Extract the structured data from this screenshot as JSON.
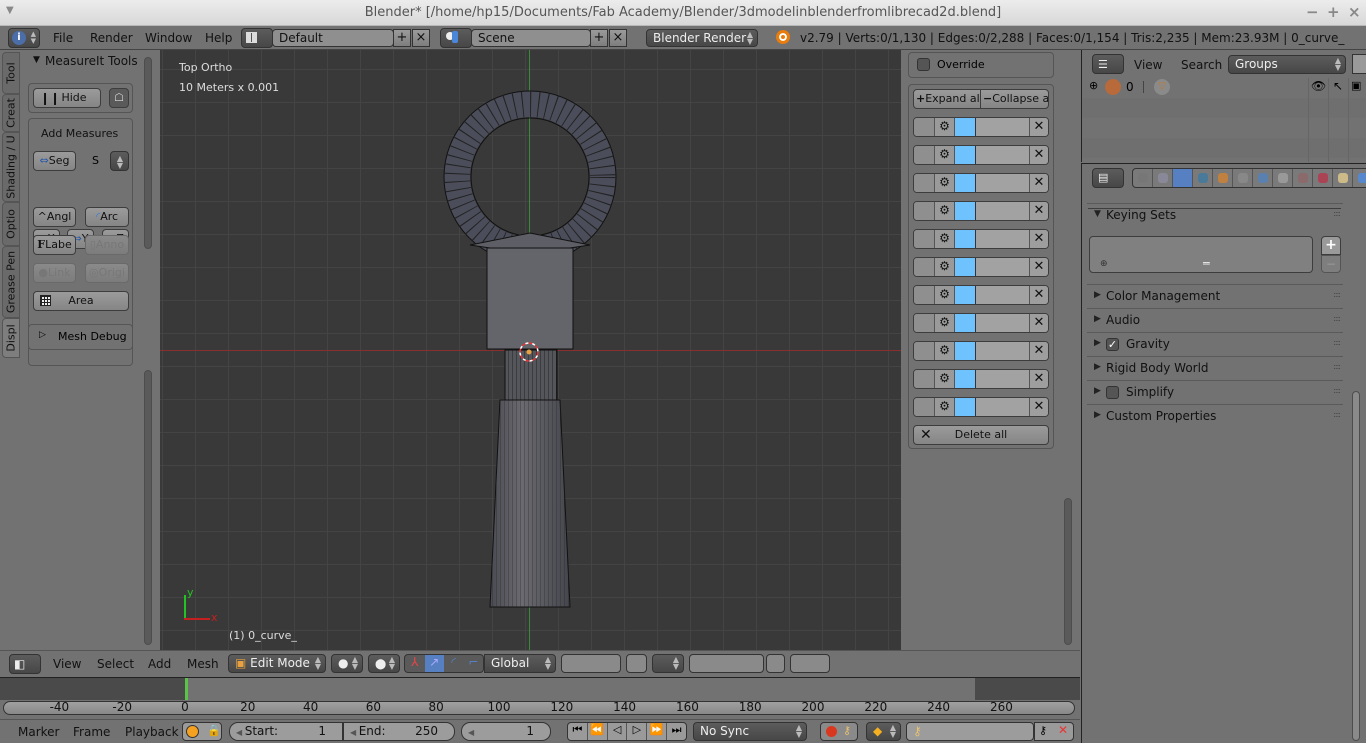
{
  "window": {
    "title": "Blender* [/home/hp15/Documents/Fab Academy/Blender/3dmodelinblenderfromlibrecad2d.blend]",
    "controls": [
      "−",
      "+",
      "×"
    ]
  },
  "info_header": {
    "editor_icon": "info-icon",
    "menus": [
      "File",
      "Render",
      "Window",
      "Help"
    ],
    "screen_layout": "Default",
    "scene": "Scene",
    "render_engine": "Blender Render",
    "stats": "v2.79 | Verts:0/1,130 | Edges:0/2,288 | Faces:0/1,154 | Tris:2,235 | Mem:23.93M | 0_curve_"
  },
  "tool_shelf": {
    "tabs": [
      "Tool",
      "Creat",
      "Shading / U",
      "Optio",
      "Grease Pen",
      "Displ"
    ],
    "active_tab": "Displ",
    "panel_title": "MeasureIt Tools",
    "hide_button": "Hide",
    "add_measures_label": "Add Measures",
    "buttons": {
      "seg": "Seg",
      "s_label": "S",
      "x": "X",
      "y": "Y",
      "z": "Z",
      "angle": "Angl",
      "arc": "Arc",
      "label": "Labe",
      "anno": "Anno",
      "link": "Link",
      "origin": "Origi",
      "area": "Area"
    },
    "mesh_debug": "Mesh Debug"
  },
  "viewport": {
    "view_name": "Top Ortho",
    "scale": "10 Meters x 0.001",
    "object_label": "(1) 0_curve_",
    "axis_x": "x",
    "axis_y": "y"
  },
  "measureit_list": {
    "override_label": "Override",
    "expand_all": "Expand al",
    "collapse_all": "Collapse a",
    "rows": 11,
    "row_color": "#6ec3ff",
    "delete_all": "Delete all"
  },
  "outliner": {
    "menus": [
      "View",
      "Search"
    ],
    "display_mode": "Groups",
    "rows": [
      {
        "label": "0"
      }
    ]
  },
  "properties": {
    "tabs": [
      "render",
      "render-layers",
      "scene",
      "world",
      "object",
      "constraints",
      "modifiers",
      "data",
      "material",
      "texture",
      "particles",
      "physics"
    ],
    "active_tab": "scene",
    "panels": [
      {
        "label": "Keying Sets",
        "expanded": true
      },
      {
        "label": "Color Management",
        "expanded": false
      },
      {
        "label": "Audio",
        "expanded": false
      },
      {
        "label": "Gravity",
        "expanded": false,
        "checkbox": true,
        "checked": true
      },
      {
        "label": "Rigid Body World",
        "expanded": false
      },
      {
        "label": "Simplify",
        "expanded": false,
        "checkbox": true,
        "checked": false
      },
      {
        "label": "Custom Properties",
        "expanded": false
      }
    ]
  },
  "view3d_header": {
    "menus": [
      "View",
      "Select",
      "Add",
      "Mesh"
    ],
    "mode": "Edit Mode",
    "orientation": "Global"
  },
  "timeline": {
    "ticks": [
      "-40",
      "-20",
      "0",
      "20",
      "40",
      "60",
      "80",
      "100",
      "120",
      "140",
      "160",
      "180",
      "200",
      "220",
      "240",
      "260"
    ],
    "current_frame": 1,
    "menus": [
      "Marker",
      "Frame",
      "Playback"
    ],
    "start_label": "Start:",
    "start": "1",
    "end_label": "End:",
    "end": "250",
    "frame": "1",
    "sync": "No Sync"
  }
}
